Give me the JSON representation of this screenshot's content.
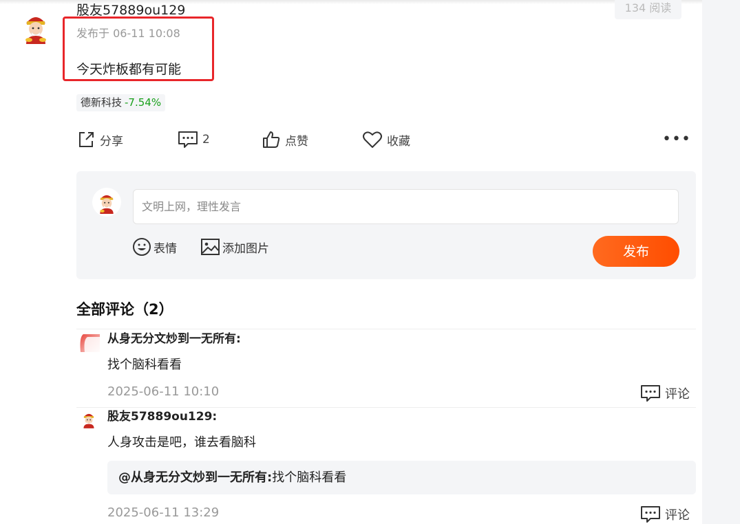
{
  "post": {
    "username": "股友57889ou129",
    "read_count": "134 阅读",
    "publish_time": "发布于 06-11 10:08",
    "content": "今天炸板都有可能",
    "stock": {
      "name": "德新科技",
      "change": "-7.54%",
      "change_color": "#19a01b"
    },
    "actions": {
      "share_label": "分享",
      "comment_count": "2",
      "like_label": "点赞",
      "favorite_label": "收藏"
    }
  },
  "composer": {
    "placeholder": "文明上网，理性发言",
    "emoji_label": "表情",
    "image_label": "添加图片",
    "publish_label": "发布",
    "accent_color": "#ff5a0a"
  },
  "comments": {
    "title": "全部评论（2）",
    "reply_label": "评论",
    "items": [
      {
        "author": "从身无分文炒到一无所有:",
        "text": "找个脑科看看",
        "time": "2025-06-11 10:10"
      },
      {
        "author": "股友57889ou129:",
        "text": "人身攻击是吧，谁去看脑科",
        "quote_author": "@从身无分文炒到一无所有:",
        "quote_text": "找个脑科看看",
        "time": "2025-06-11 13:29"
      }
    ]
  },
  "highlight_color": "#e8262a"
}
